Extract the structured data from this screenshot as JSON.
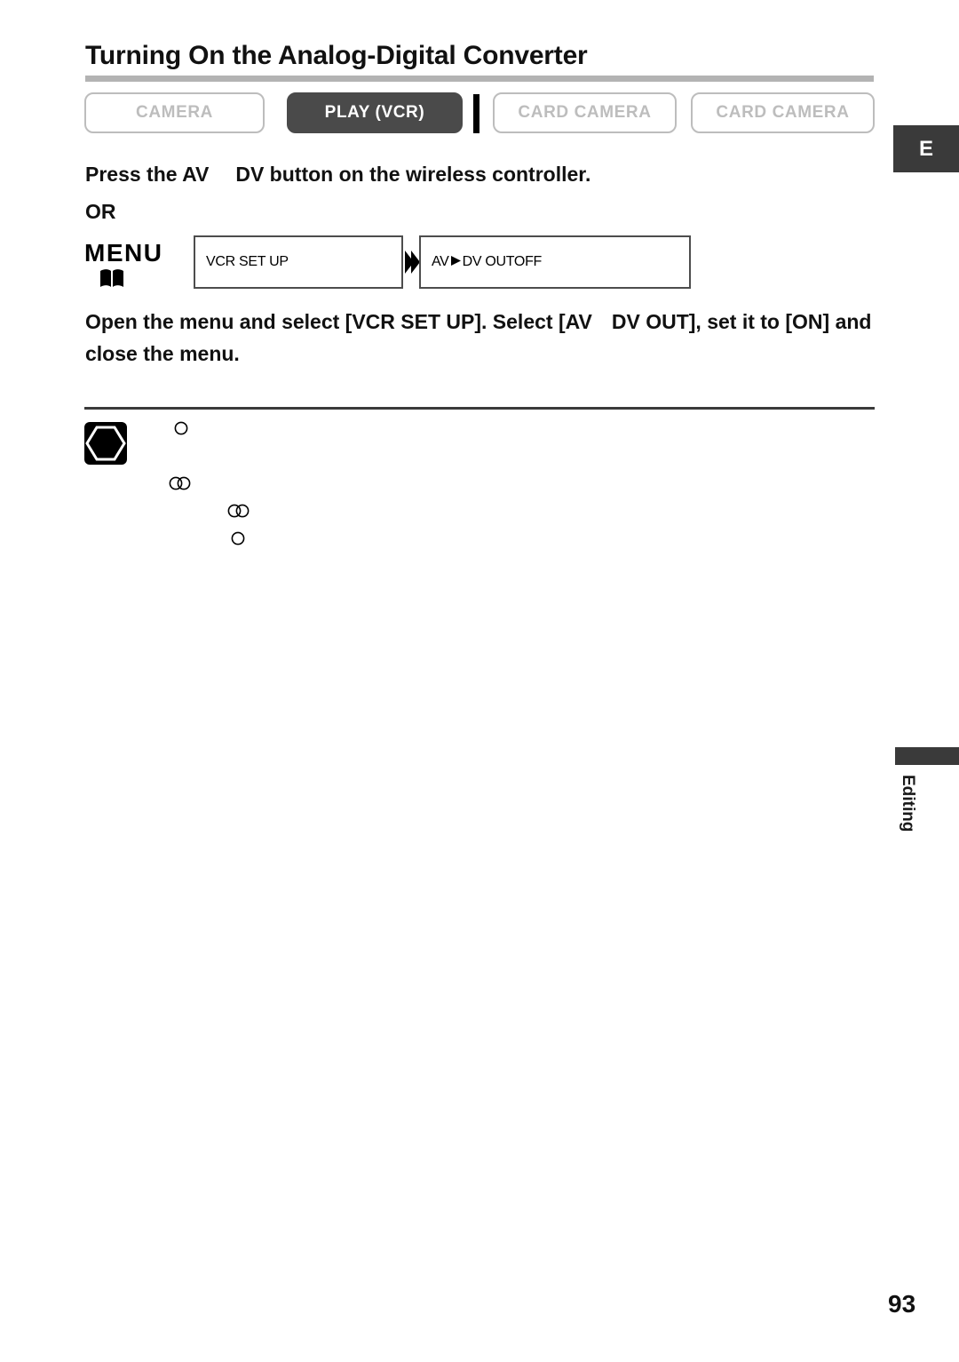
{
  "page": {
    "title": "Turning On the Analog-Digital Converter",
    "page_number": "93",
    "language_tab": "E",
    "section_tab": "Editing"
  },
  "mode_buttons": [
    {
      "label": "CAMERA",
      "state": "inactive"
    },
    {
      "label": "PLAY (VCR)",
      "state": "active"
    },
    {
      "label": "CARD CAMERA",
      "state": "inactive"
    },
    {
      "label": "CARD CAMERA",
      "state": "inactive"
    }
  ],
  "instructions": {
    "lead_before": "Press the AV",
    "lead_after": "DV button on the wireless controller.",
    "or": "OR",
    "menu_word": "MENU",
    "body_part1": "Open the menu and select [VCR SET UP]. Select [AV",
    "body_part2": "DV OUT], set it to [ON] and close the menu."
  },
  "lcd_boxes": [
    {
      "text": "VCR SET UP"
    },
    {
      "text_before": "AV",
      "text_after": "DV OUT",
      "value": "OFF"
    }
  ],
  "colors": {
    "active_button": "#4a4a4a",
    "inactive_border": "#bdbdbd",
    "title_rule": "#b3b3b3",
    "tab_dark": "#3a3a3a"
  }
}
